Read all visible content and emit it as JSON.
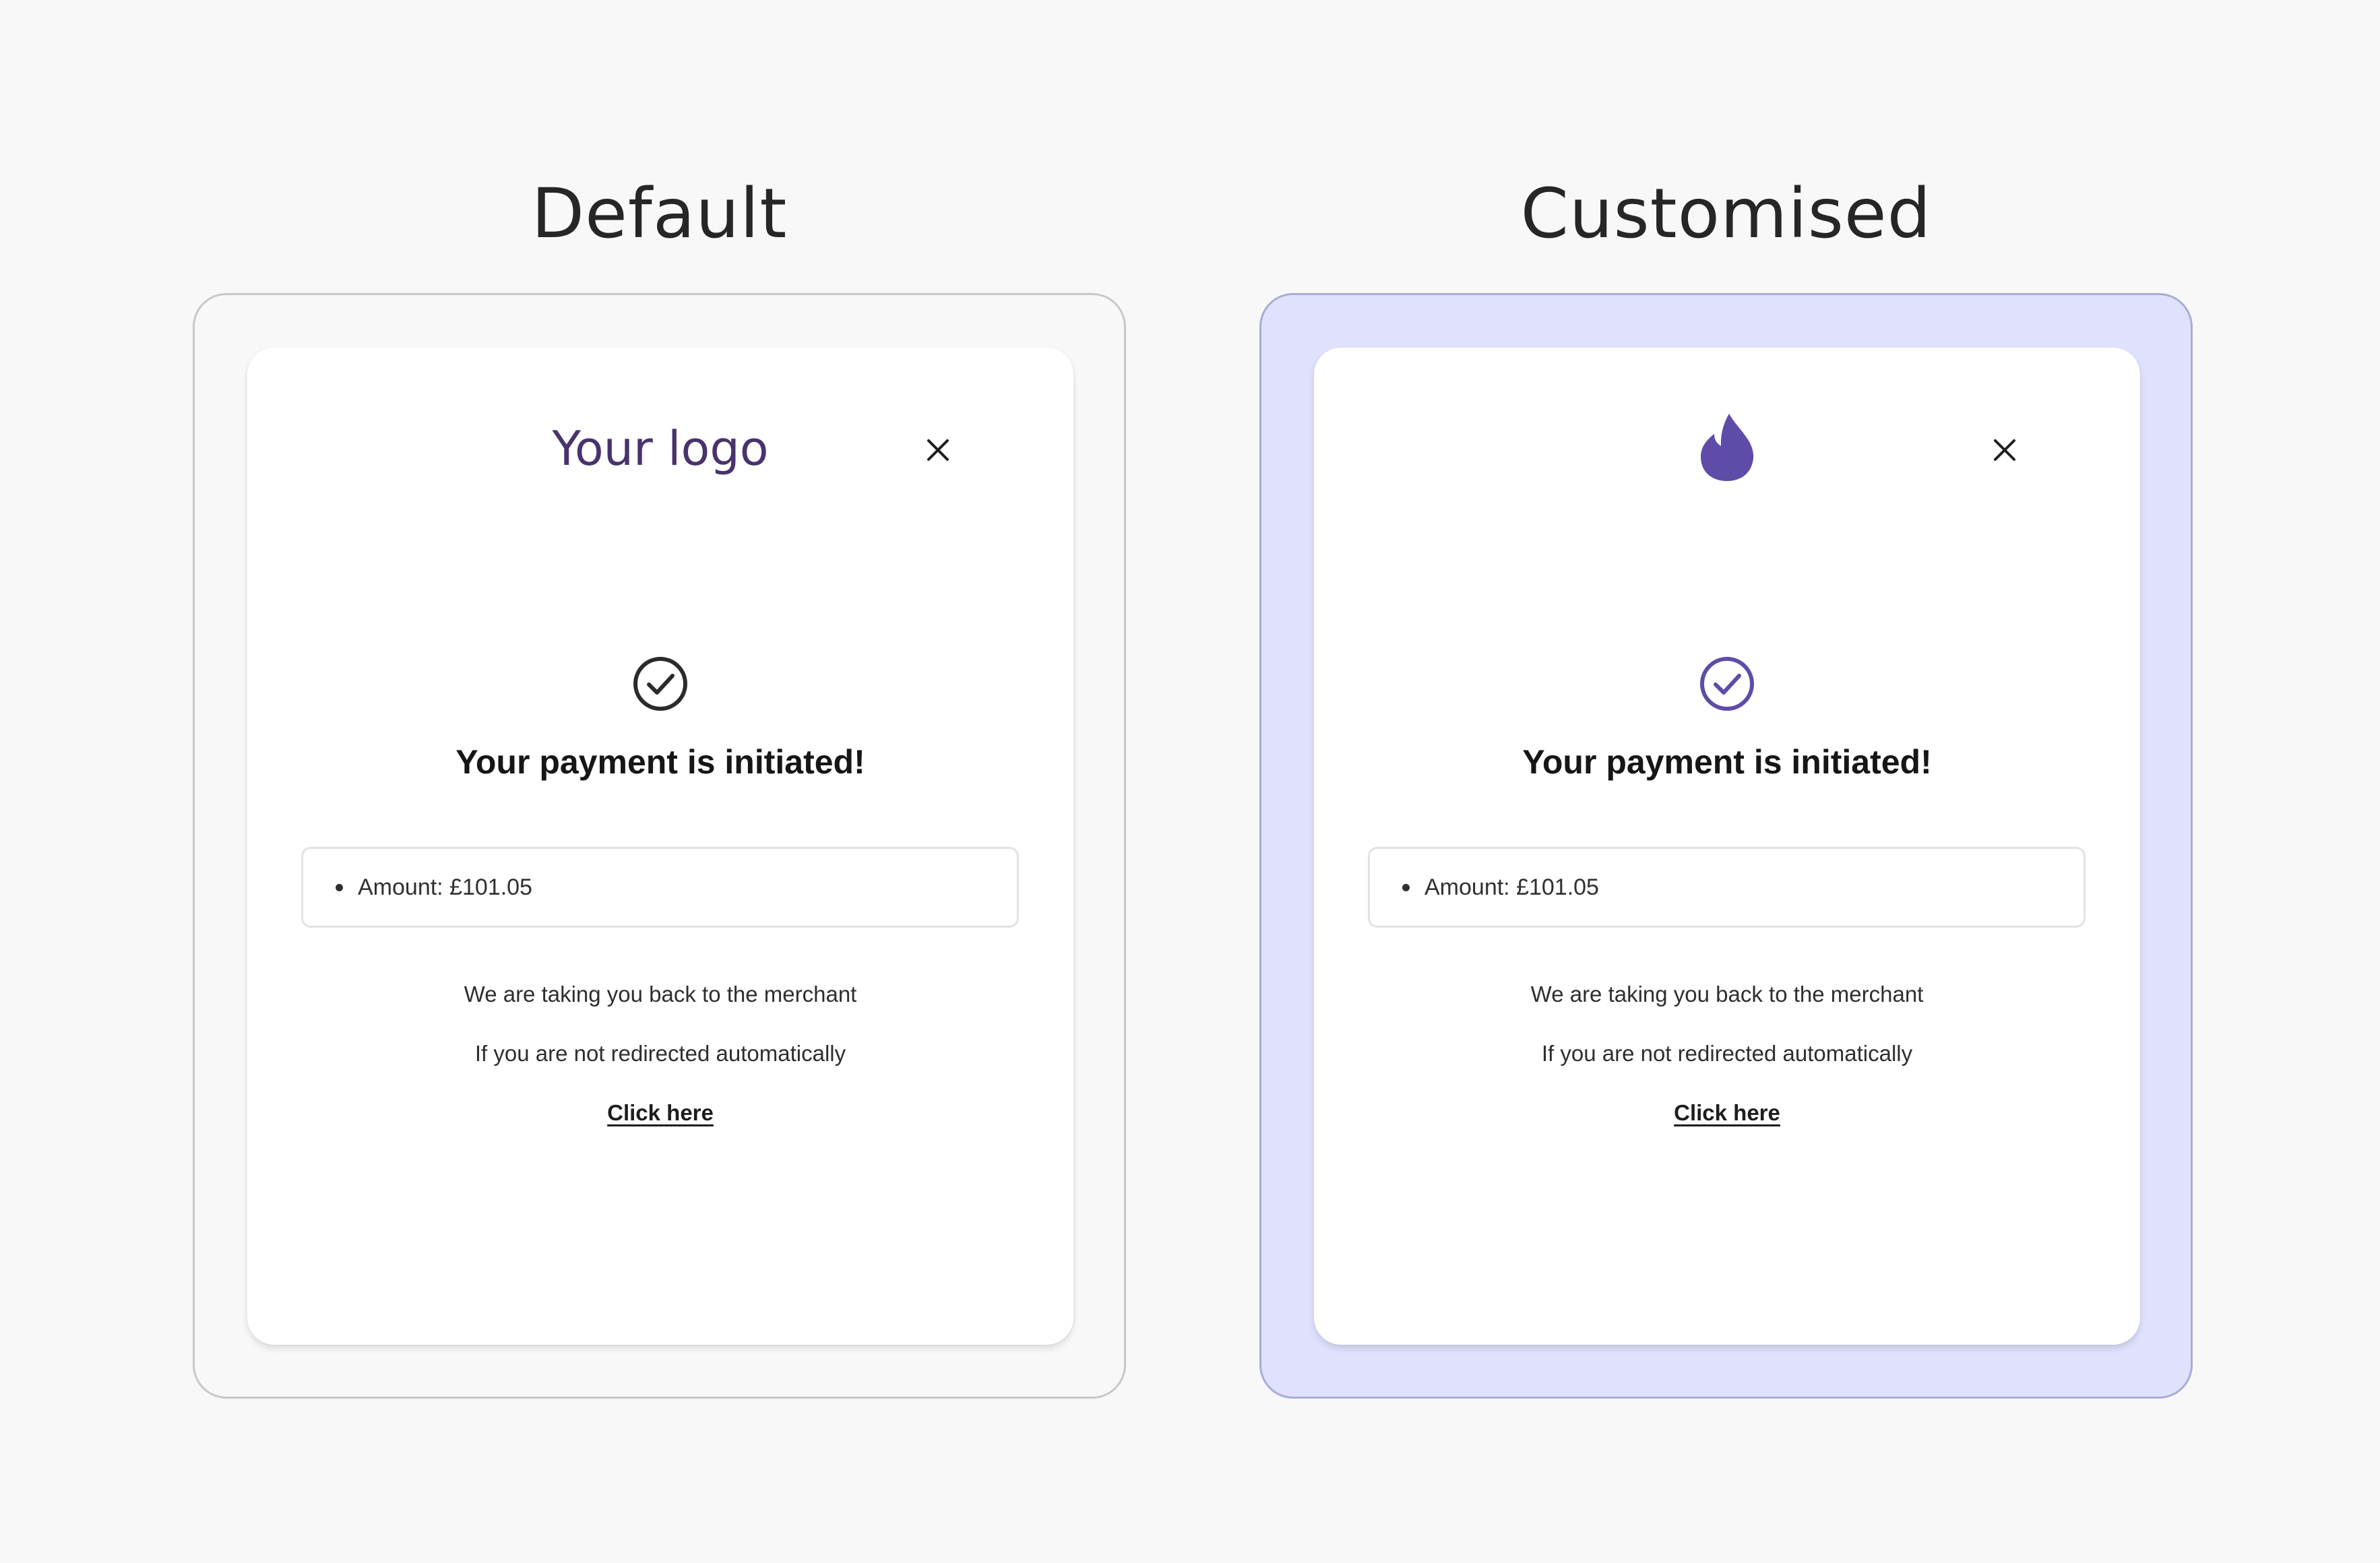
{
  "headings": {
    "default": "Default",
    "customised": "Customised"
  },
  "colors": {
    "page_background": "#f8f8f8",
    "customised_frame_background": "#dfe1fd",
    "logo_text": "#48336d",
    "brand_purple": "#5f4ba8",
    "default_check": "#2b2b2b"
  },
  "default_panel": {
    "logo": "Your logo",
    "close_icon": "close-icon",
    "check_icon": "check-circle-icon",
    "title": "Your payment is initiated!",
    "amount": "Amount: £101.05",
    "message_1": "We are taking you back to the merchant",
    "message_2": "If you are not redirected automatically",
    "link": "Click here"
  },
  "customised_panel": {
    "logo_icon": "flame-logo-icon",
    "close_icon": "close-icon",
    "check_icon": "check-circle-icon",
    "title": "Your payment is initiated!",
    "amount": "Amount: £101.05",
    "message_1": "We are taking you back to the merchant",
    "message_2": "If you are not redirected automatically",
    "link": "Click here"
  }
}
